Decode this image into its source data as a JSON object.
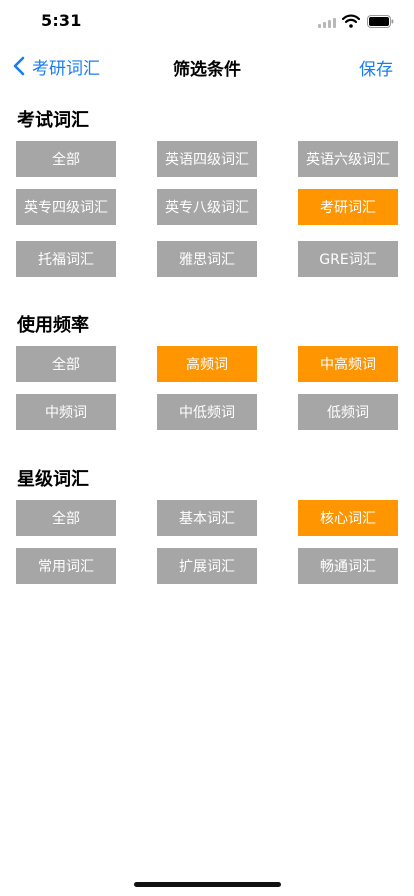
{
  "status_bar": {
    "time": "5:31",
    "icons": [
      "signal-icon",
      "wifi-icon",
      "battery-icon"
    ]
  },
  "nav": {
    "back_label": "考研词汇",
    "title": "筛选条件",
    "save_label": "保存",
    "accent_color": "#1a7cf5"
  },
  "colors": {
    "chip_default": "#a6a6a6",
    "chip_selected": "#ff9500",
    "chip_text": "#ffffff"
  },
  "sections": [
    {
      "title": "考试词汇",
      "options": [
        {
          "label": "全部",
          "selected": false
        },
        {
          "label": "英语四级词汇",
          "selected": false
        },
        {
          "label": "英语六级词汇",
          "selected": false
        },
        {
          "label": "英专四级词汇",
          "selected": false
        },
        {
          "label": "英专八级词汇",
          "selected": false
        },
        {
          "label": "考研词汇",
          "selected": true
        },
        {
          "label": "托福词汇",
          "selected": false
        },
        {
          "label": "雅思词汇",
          "selected": false
        },
        {
          "label": "GRE词汇",
          "selected": false
        }
      ]
    },
    {
      "title": "使用频率",
      "options": [
        {
          "label": "全部",
          "selected": false
        },
        {
          "label": "高频词",
          "selected": true
        },
        {
          "label": "中高频词",
          "selected": true
        },
        {
          "label": "中频词",
          "selected": false
        },
        {
          "label": "中低频词",
          "selected": false
        },
        {
          "label": "低频词",
          "selected": false
        }
      ]
    },
    {
      "title": "星级词汇",
      "options": [
        {
          "label": "全部",
          "selected": false
        },
        {
          "label": "基本词汇",
          "selected": false
        },
        {
          "label": "核心词汇",
          "selected": true
        },
        {
          "label": "常用词汇",
          "selected": false
        },
        {
          "label": "扩展词汇",
          "selected": false
        },
        {
          "label": "畅通词汇",
          "selected": false
        }
      ]
    }
  ]
}
